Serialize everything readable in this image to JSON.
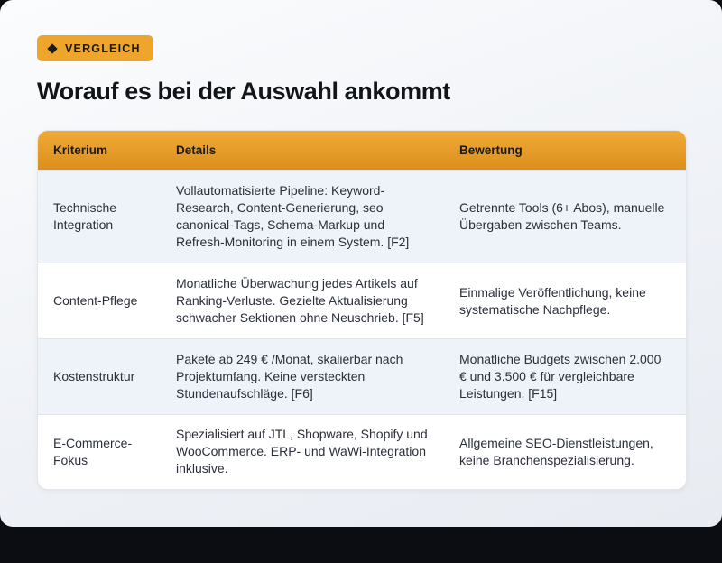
{
  "badge": {
    "icon": "diamond-icon",
    "label": "VERGLEICH",
    "color": "#efa52c"
  },
  "title": "Worauf es bei der Auswahl ankommt",
  "table": {
    "headers": [
      "Kriterium",
      "Details",
      "Bewertung"
    ],
    "rows": [
      {
        "criterion": "Technische Integration",
        "details": "Vollautomatisierte Pipeline: Keyword-Research, Content-Generierung, seo canonical-Tags, Schema-Markup und Refresh-Monitoring in einem System. [F2]",
        "rating": "Getrennte Tools (6+ Abos), manuelle Übergaben zwischen Teams."
      },
      {
        "criterion": "Content-Pflege",
        "details": "Monatliche Überwachung jedes Artikels auf Ranking-Verluste. Gezielte Aktualisierung schwacher Sektionen ohne Neuschrieb. [F5]",
        "rating": "Einmalige Veröffentlichung, keine systematische Nachpflege."
      },
      {
        "criterion": "Kostenstruktur",
        "details": "Pakete ab 249 € /Monat, skalierbar nach Projektumfang. Keine versteckten Stundenaufschläge. [F6]",
        "rating": "Monatliche Budgets zwischen 2.000 € und 3.500 € für vergleichbare Leistungen. [F15]"
      },
      {
        "criterion": "E-Commerce-Fokus",
        "details": "Spezialisiert auf JTL, Shopware, Shopify und WooCommerce. ERP- und WaWi-Integration inklusive.",
        "rating": "Allgemeine SEO-Dienstleistungen, keine Branchenspezialisierung."
      }
    ]
  }
}
